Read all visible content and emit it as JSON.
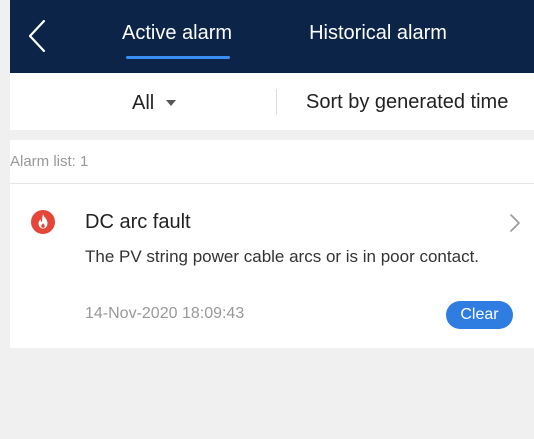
{
  "header": {
    "back_icon": "chevron-left-icon",
    "tabs": [
      {
        "label": "Active alarm",
        "active": true
      },
      {
        "label": "Historical alarm",
        "active": false
      }
    ],
    "background_color": "#0b2447",
    "accent_color": "#3a8df5"
  },
  "filter": {
    "selected": "All",
    "sort_label": "Sort by generated time"
  },
  "alarm_list": {
    "count_label": "Alarm list: 1",
    "items": [
      {
        "icon": "fire-icon",
        "icon_color": "#e4463a",
        "title": "DC arc fault",
        "description": "The PV string power cable arcs or is in poor contact.",
        "timestamp": "14-Nov-2020 18:09:43",
        "action_label": "Clear",
        "action_color": "#2f7de1"
      }
    ]
  }
}
